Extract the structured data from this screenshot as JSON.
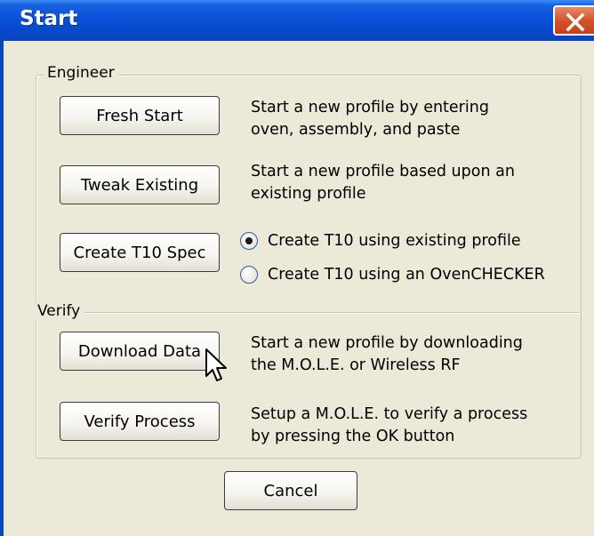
{
  "window": {
    "title": "Start",
    "close_icon": "close-icon"
  },
  "engineer": {
    "legend": "Engineer",
    "fresh_start": {
      "label": "Fresh Start",
      "desc_lines": [
        "Start a new profile by entering",
        "oven, assembly, and paste"
      ]
    },
    "tweak_existing": {
      "label": "Tweak Existing",
      "desc_lines": [
        "Start a new profile based upon an",
        "existing profile"
      ]
    },
    "create_t10": {
      "label": "Create T10 Spec",
      "options": [
        {
          "label": "Create T10 using existing profile",
          "selected": true
        },
        {
          "label": "Create T10 using an OvenCHECKER",
          "selected": false
        }
      ]
    }
  },
  "verify": {
    "legend": "Verify",
    "download_data": {
      "label": "Download Data",
      "desc_lines": [
        "Start a new profile by downloading",
        "the M.O.L.E. or Wireless RF"
      ]
    },
    "verify_process": {
      "label": "Verify Process",
      "desc_lines": [
        "Setup a M.O.L.E. to verify a process",
        "by pressing the OK button"
      ]
    }
  },
  "footer": {
    "cancel_label": "Cancel"
  },
  "colors": {
    "title_bar": "#0a50d8",
    "dialog_bg": "#ece9d8",
    "close_button": "#d4532c"
  }
}
